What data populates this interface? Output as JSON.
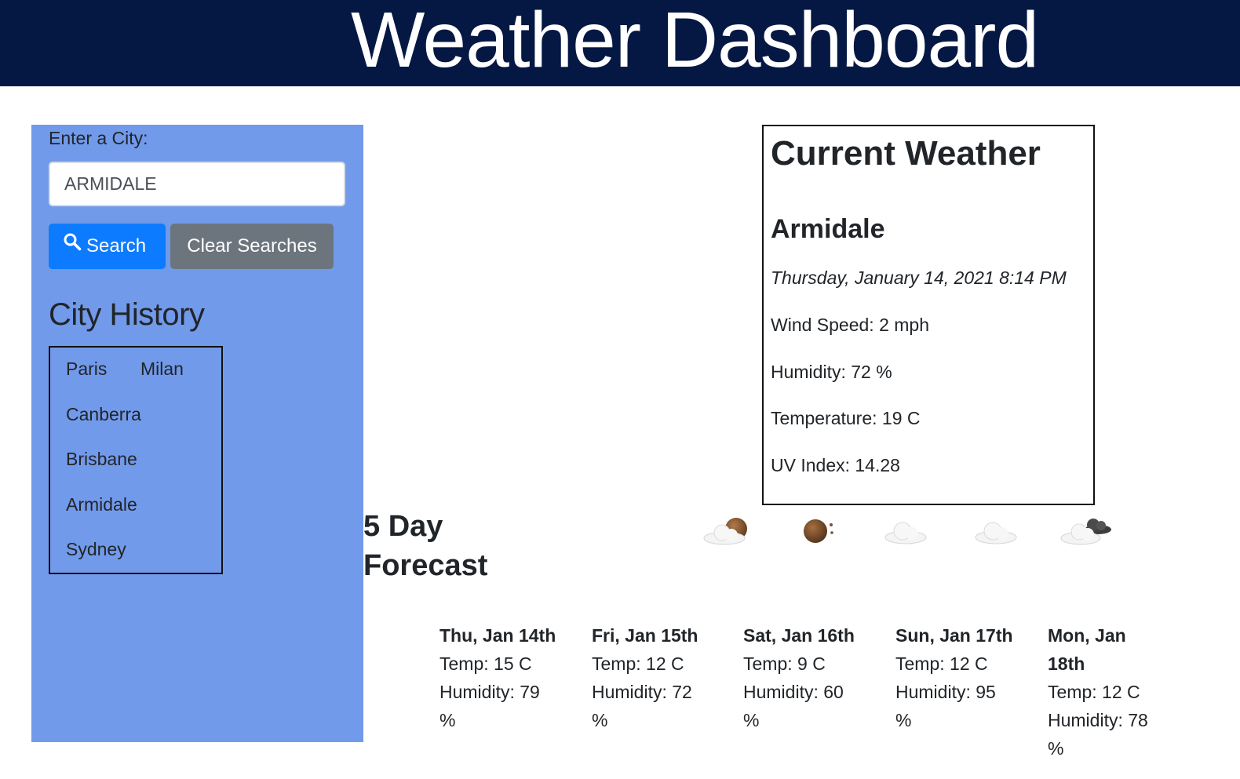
{
  "header": {
    "title": "Weather Dashboard"
  },
  "search": {
    "label": "Enter a City:",
    "input_value": "ARMIDALE",
    "search_label": "Search",
    "clear_label": "Clear Searches"
  },
  "history": {
    "title": "City History",
    "cities": [
      "Paris",
      "Milan",
      "Canberra",
      "Brisbane",
      "Armidale",
      "Sydney"
    ]
  },
  "current": {
    "title": "Current Weather",
    "city": "Armidale",
    "datetime": "Thursday, January 14, 2021 8:14 PM",
    "wind": "Wind Speed: 2 mph",
    "humidity": "Humidity: 72 %",
    "temperature": "Temperature: 19 C",
    "uv": "UV Index: 14.28"
  },
  "forecast": {
    "title_line1": "5 Day",
    "title_line2": "Forecast",
    "icons": [
      "cloud-moon-icon",
      "moon-icon",
      "cloud-icon",
      "cloud-icon",
      "dark-clouds-icon"
    ],
    "days": [
      {
        "date": "Thu, Jan 14th",
        "temp": "Temp: 15 C",
        "humidity": "Humidity: 79 %"
      },
      {
        "date": "Fri, Jan 15th",
        "temp": "Temp: 12 C",
        "humidity": "Humidity: 72 %"
      },
      {
        "date": "Sat, Jan 16th",
        "temp": "Temp: 9 C",
        "humidity": "Humidity: 60 %"
      },
      {
        "date": "Sun, Jan 17th",
        "temp": "Temp: 12 C",
        "humidity": "Humidity: 95 %"
      },
      {
        "date": "Mon, Jan 18th",
        "temp": "Temp: 12 C",
        "humidity": "Humidity: 78 %"
      }
    ]
  },
  "colors": {
    "header_bg": "#041843",
    "sidebar_bg": "#729aeb",
    "search_button": "#0d7bff",
    "clear_button": "#6c757d"
  }
}
